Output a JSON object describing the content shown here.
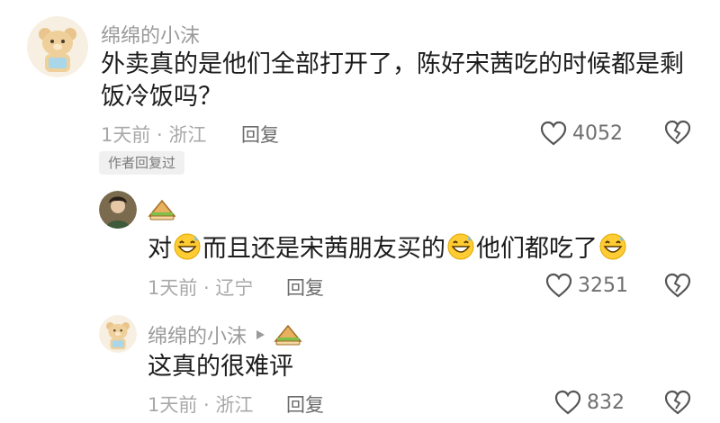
{
  "comment1": {
    "username": "绵绵的小沫",
    "text": "外卖真的是他们全部打开了，陈好宋茜吃的时候都是剩饭冷饭吗？",
    "meta": "1天前 · 浙江",
    "reply_label": "回复",
    "likes": "4052",
    "badge": "作者回复过"
  },
  "reply1": {
    "text_parts": [
      "对",
      "而且还是宋茜朋友买的",
      "他们都吃了"
    ],
    "meta": "1天前 · 辽宁",
    "reply_label": "回复",
    "likes": "3251"
  },
  "reply2": {
    "username": "绵绵的小沫",
    "text": "这真的很难评",
    "meta": "1天前 · 浙江",
    "reply_label": "回复",
    "likes": "832"
  },
  "icons": {
    "like": "heart-outline-icon",
    "dislike": "broken-heart-icon",
    "reply_arrow": "triangle-right-icon",
    "sandwich": "sandwich-sticker-icon",
    "emoji": "grinning-sweat-emoji"
  },
  "colors": {
    "text_primary": "#1c1c1c",
    "text_secondary": "#9a9a9a",
    "badge_bg": "#f0f0f0"
  }
}
